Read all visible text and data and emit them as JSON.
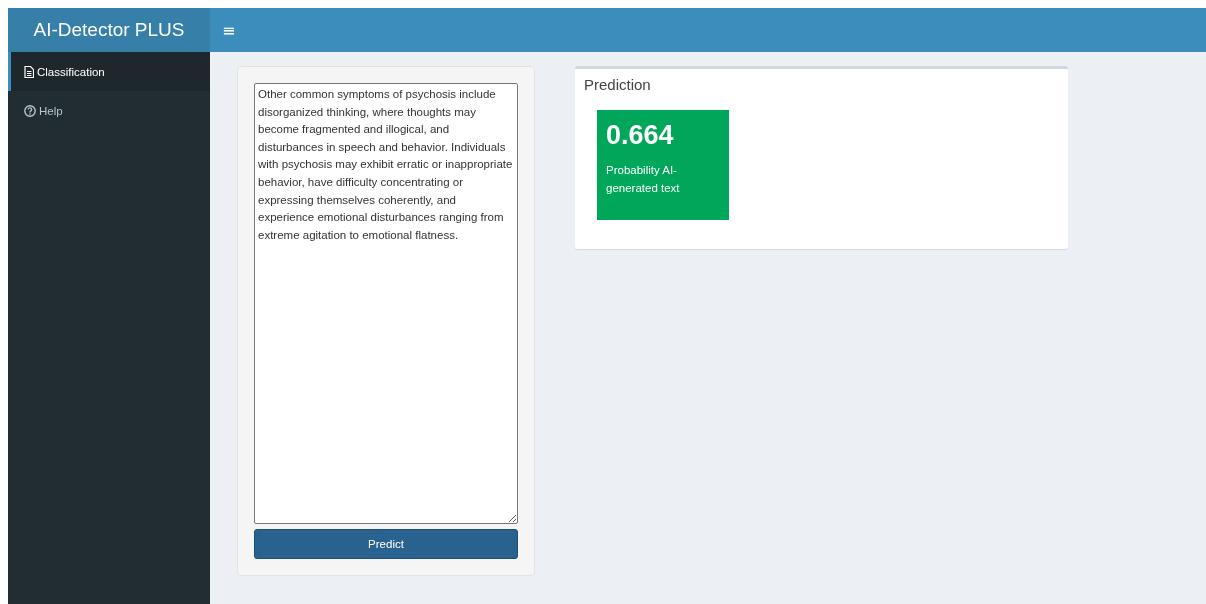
{
  "header": {
    "logo": "AI-Detector PLUS",
    "menu_toggle": "≡"
  },
  "sidebar": {
    "items": [
      {
        "label": "Classification",
        "selected": true
      },
      {
        "label": "Help",
        "selected": false
      }
    ]
  },
  "input_panel": {
    "text": "Other common symptoms of psychosis include disorganized thinking, where thoughts may become fragmented and illogical, and disturbances in speech and behavior. Individuals with psychosis may exhibit erratic or inappropriate behavior, have difficulty concentrating or expressing themselves coherently, and experience emotional disturbances ranging from extreme agitation to emotional flatness.",
    "button": "Predict"
  },
  "prediction_box": {
    "title": "Prediction",
    "value_box": {
      "value": "0.664",
      "subtitle": "Probability AI-generated text",
      "color": "#00a65a"
    }
  }
}
